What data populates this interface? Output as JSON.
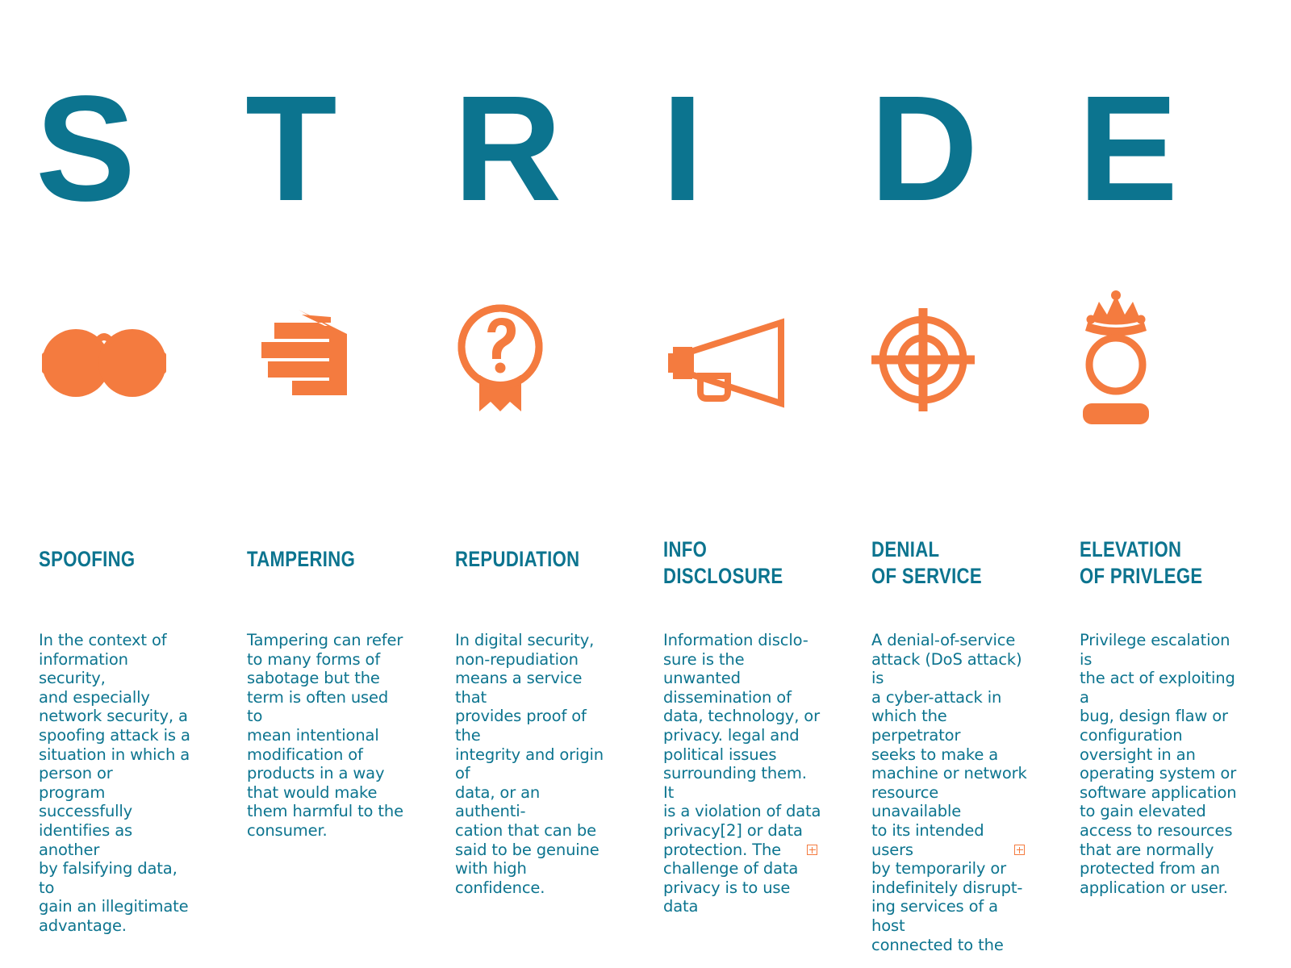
{
  "title": {
    "word": "STRIDE",
    "letters": [
      "S",
      "T",
      "R",
      "I",
      "D",
      "E"
    ]
  },
  "colors": {
    "teal": "#0c748f",
    "orange": "#f47b3f",
    "background": "#ffffff"
  },
  "columns": [
    {
      "id": "spoofing",
      "icon": "glasses-icon",
      "heading_lines": [
        "SPOOFING"
      ],
      "heading_text": "SPOOFING",
      "body": "In the context of\ninformation security,\nand especially\nnetwork security, a\nspoofing attack is a\nsituation in which a\nperson or\nprogram successfully\nidentifies as another\nby falsifying data, to\ngain an illegitimate\nadvantage.",
      "overset": false
    },
    {
      "id": "tampering",
      "icon": "hand-icon",
      "heading_lines": [
        "TAMPERING"
      ],
      "heading_text": "TAMPERING",
      "body": "Tampering can refer\nto many forms of\nsabotage but the\nterm is often used to\nmean intentional\nmodification of\nproducts in a way\nthat would make\nthem harmful to the\nconsumer.",
      "overset": false
    },
    {
      "id": "repudiation",
      "icon": "question-badge-icon",
      "heading_lines": [
        "REPUDIATION"
      ],
      "heading_text": "REPUDIATION",
      "body": "In digital security,\nnon-repudiation\nmeans a service that\nprovides proof of the\nintegrity and origin of\ndata, or an authenti-\ncation that can be\nsaid to be genuine\nwith high confidence.",
      "overset": false
    },
    {
      "id": "info-disclosure",
      "icon": "megaphone-icon",
      "heading_lines": [
        "INFO",
        "DISCLOSURE"
      ],
      "heading_text": "INFO DISCLOSURE",
      "body": "Information disclo-\nsure is the unwanted\ndissemination of\ndata, technology, or\nprivacy. legal and\npolitical issues\nsurrounding them. It\nis a violation of data\nprivacy[2] or data\nprotection. The\nchallenge of data\nprivacy is to use data",
      "overset": true
    },
    {
      "id": "denial-of-service",
      "icon": "crosshair-icon",
      "heading_lines": [
        "DENIAL",
        "OF SERVICE"
      ],
      "heading_text": "DENIAL OF SERVICE",
      "body": "A denial-of-service\nattack (DoS attack) is\na cyber-attack in\nwhich the perpetrator\nseeks to make a\nmachine or network\nresource unavailable\nto its intended users\nby temporarily or\nindefinitely disrupt-\ning services of a host\nconnected to the",
      "overset": true
    },
    {
      "id": "elevation-of-privilege",
      "icon": "crowned-user-icon",
      "heading_lines": [
        "ELEVATION",
        "OF PRIVLEGE"
      ],
      "heading_text": "ELEVATION OF PRIVLEGE",
      "body": "Privilege escalation is\nthe act of exploiting a\nbug, design flaw or\nconfiguration\noversight in an\noperating system or\nsoftware application\nto gain elevated\naccess to resources\nthat are normally\nprotected from an\napplication or user.",
      "overset": false
    }
  ]
}
